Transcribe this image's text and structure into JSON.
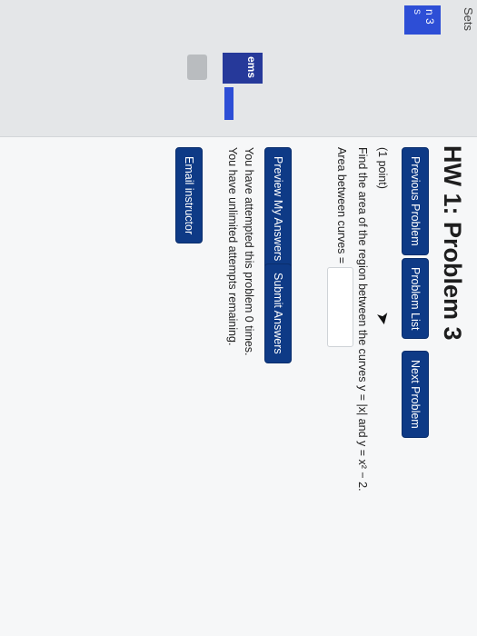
{
  "sidenav": {
    "sets_label": "Sets",
    "item_3_label": "n 3",
    "item_s_label": "s",
    "problems_label": "ems"
  },
  "header": {
    "title": "HW 1: Problem 3"
  },
  "nav_buttons": {
    "previous": "Previous Problem",
    "list": "Problem List",
    "next": "Next Problem"
  },
  "problem": {
    "points": "(1 point)",
    "text": "Find the area of the region between the curves y = |x| and y = x² − 2.",
    "answer_label": "Area between curves =",
    "answer_value": ""
  },
  "actions": {
    "preview": "Preview My Answers",
    "submit": "Submit Answers"
  },
  "status": {
    "attempted": "You have attempted this problem 0 times.",
    "remaining": "You have unlimited attempts remaining."
  },
  "footer": {
    "email": "Email instructor"
  },
  "colors": {
    "button_bg": "#0e3a86",
    "nav_active": "#2d4ed6"
  }
}
